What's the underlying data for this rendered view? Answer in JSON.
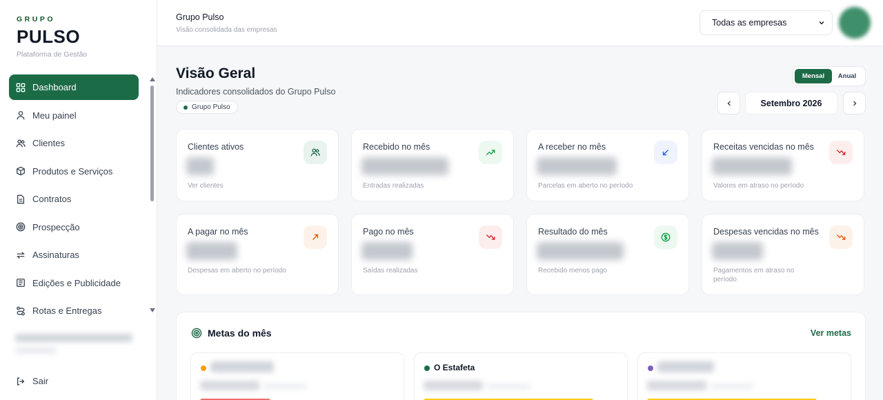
{
  "brand": {
    "small": "GRUPO",
    "big": "PULSO",
    "subtitle": "Plataforma de Gestão"
  },
  "sidebar": {
    "items": [
      {
        "label": "Dashboard",
        "icon": "grid-icon",
        "active": true
      },
      {
        "label": "Meu painel",
        "icon": "user-icon"
      },
      {
        "label": "Clientes",
        "icon": "users-icon"
      },
      {
        "label": "Produtos e Serviços",
        "icon": "box-icon"
      },
      {
        "label": "Contratos",
        "icon": "document-icon"
      },
      {
        "label": "Prospecção",
        "icon": "target-icon"
      },
      {
        "label": "Assinaturas",
        "icon": "repeat-icon"
      },
      {
        "label": "Edições e Publicidade",
        "icon": "newspaper-icon"
      },
      {
        "label": "Rotas e Entregas",
        "icon": "route-icon"
      }
    ],
    "logout_label": "Sair"
  },
  "topbar": {
    "title": "Grupo Pulso",
    "subtitle": "Visão consolidada das empresas",
    "company_select": "Todas as empresas"
  },
  "main": {
    "title": "Visão Geral",
    "subtitle": "Indicadores consolidados do Grupo Pulso",
    "tag": "Grupo Pulso",
    "toggle": {
      "monthly": "Mensal",
      "annual": "Anual",
      "selected": "Mensal"
    },
    "month": "Setembro 2026"
  },
  "cards": [
    {
      "title": "Clientes ativos",
      "footer": "Ver clientes",
      "icon": "users-icon",
      "color": "#1c6b47",
      "bg": "#e8f3ee"
    },
    {
      "title": "Recebido no mês",
      "footer": "Entradas realizadas",
      "icon": "trend-up-icon",
      "color": "#16a34a",
      "bg": "#ecf8f0"
    },
    {
      "title": "A receber no mês",
      "footer": "Parcelas em aberto no período",
      "icon": "arrow-down-left-icon",
      "color": "#2563eb",
      "bg": "#eef3fd"
    },
    {
      "title": "Receitas vencidas no mês",
      "footer": "Valores em atraso no período",
      "icon": "trend-down-icon",
      "color": "#dc2626",
      "bg": "#fdeeee"
    },
    {
      "title": "A pagar no mês",
      "footer": "Despesas em aberto no período",
      "icon": "arrow-up-right-icon",
      "color": "#ea580c",
      "bg": "#fdf2ea"
    },
    {
      "title": "Pago no mês",
      "footer": "Saídas realizadas",
      "icon": "trend-down-icon",
      "color": "#dc2626",
      "bg": "#fdeeee"
    },
    {
      "title": "Resultado do mês",
      "footer": "Recebido menos pago",
      "icon": "dollar-circle-icon",
      "color": "#16a34a",
      "bg": "#ecf8f0"
    },
    {
      "title": "Despesas vencidas no mês",
      "footer": "Pagamentos em atraso no período",
      "icon": "trend-down-icon",
      "color": "#ea580c",
      "bg": "#fdf2ea"
    }
  ],
  "goals": {
    "title": "Metas do mês",
    "link": "Ver metas",
    "items": [
      {
        "name": "",
        "dot_color": "#f59e0b",
        "bar_color": "#ef4444"
      },
      {
        "name": "O Estafeta",
        "dot_color": "#1c6b47",
        "bar_color": "#facc15"
      },
      {
        "name": "",
        "dot_color": "#7c5cc4",
        "bar_color": "#facc15"
      }
    ]
  }
}
